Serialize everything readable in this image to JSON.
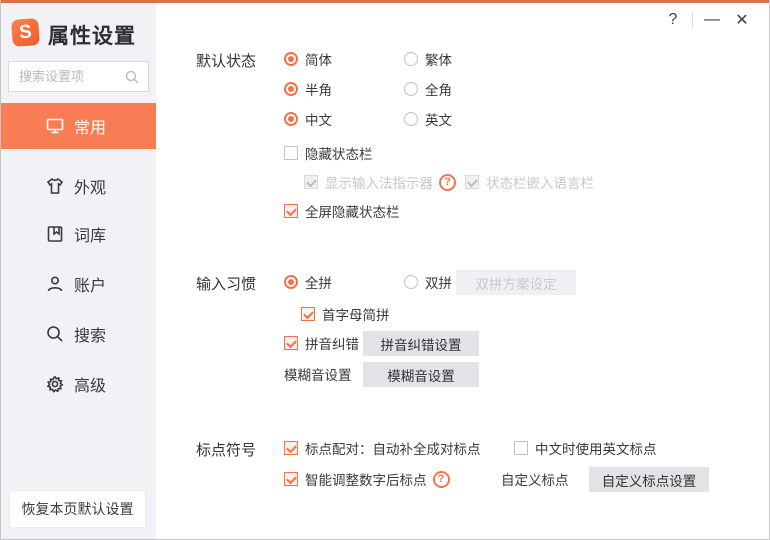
{
  "window": {
    "logo_letter": "S",
    "title": "属性设置",
    "controls": {
      "help": "?",
      "minimize": "—",
      "close": "✕"
    }
  },
  "colors": {
    "accent": "#f1714a",
    "sidebar_selected": "#f87c54",
    "sidebar_bg": "#f2f2f6",
    "button_gray": "#e2e2e7"
  },
  "sidebar": {
    "search_placeholder": "搜索设置项",
    "items": [
      {
        "label": "常用",
        "icon": "monitor-icon",
        "selected": true
      },
      {
        "label": "外观",
        "icon": "tshirt-icon",
        "selected": false
      },
      {
        "label": "词库",
        "icon": "book-icon",
        "selected": false
      },
      {
        "label": "账户",
        "icon": "user-icon",
        "selected": false
      },
      {
        "label": "搜索",
        "icon": "search-icon",
        "selected": false
      },
      {
        "label": "高级",
        "icon": "gear-icon",
        "selected": false
      }
    ],
    "restore_button": "恢复本页默认设置"
  },
  "default_state": {
    "label": "默认状态",
    "radios": [
      {
        "label": "简体",
        "checked": true
      },
      {
        "label": "繁体",
        "checked": false
      },
      {
        "label": "半角",
        "checked": true
      },
      {
        "label": "全角",
        "checked": false
      },
      {
        "label": "中文",
        "checked": true
      },
      {
        "label": "英文",
        "checked": false
      }
    ],
    "cb_hide_statusbar": {
      "label": "隐藏状态栏",
      "checked": false
    },
    "cb_show_indicator": {
      "label": "显示输入法指示器",
      "checked": true,
      "disabled": true,
      "help": "?"
    },
    "cb_embed_langbar": {
      "label": "状态栏嵌入语言栏",
      "checked": true,
      "disabled": true
    },
    "cb_fullscreen_hide": {
      "label": "全屏隐藏状态栏",
      "checked": true
    }
  },
  "input_habit": {
    "label": "输入习惯",
    "radio_quanpin": {
      "label": "全拼",
      "checked": true
    },
    "radio_shuangpin": {
      "label": "双拼",
      "checked": false
    },
    "shuangpin_button": "双拼方案设定",
    "cb_initial_jianpin": {
      "label": "首字母简拼",
      "checked": true
    },
    "cb_pinyin_correct": {
      "label": "拼音纠错",
      "checked": true
    },
    "pinyin_correct_button": "拼音纠错设置",
    "fuzzy_label": "模糊音设置",
    "fuzzy_button": "模糊音设置"
  },
  "punctuation": {
    "label": "标点符号",
    "cb_pairing": {
      "label": "标点配对：自动补全成对标点",
      "checked": true
    },
    "cb_english_punct": {
      "label": "中文时使用英文标点",
      "checked": false
    },
    "cb_smart_adjust": {
      "label": "智能调整数字后标点",
      "checked": true,
      "help": "?"
    },
    "custom_label": "自定义标点",
    "custom_button": "自定义标点设置"
  }
}
